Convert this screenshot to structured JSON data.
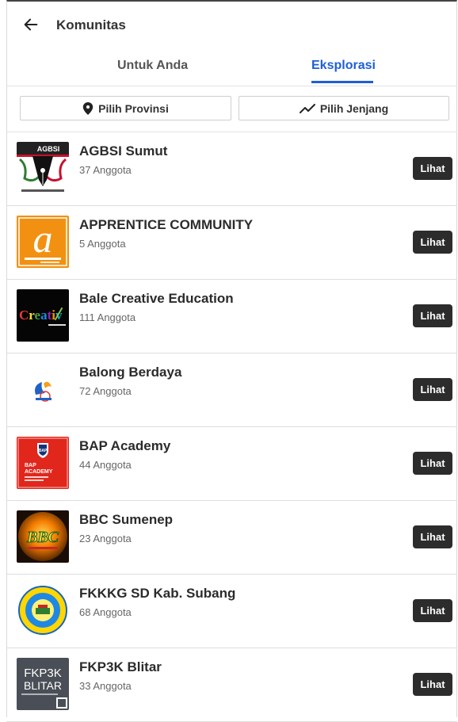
{
  "header": {
    "title": "Komunitas"
  },
  "tabs": [
    {
      "label": "Untuk Anda"
    },
    {
      "label": "Eksplorasi"
    }
  ],
  "filters": {
    "province": "Pilih Provinsi",
    "level": "Pilih Jenjang"
  },
  "communities": [
    {
      "name": "AGBSI Sumut",
      "members": "37 Anggota",
      "button": "Lihat",
      "logo_text": "AGBSI",
      "logo_icon": "pen-nib-logo"
    },
    {
      "name": "APPRENTICE COMMUNITY",
      "members": "5 Anggota",
      "button": "Lihat",
      "logo_text": "apprentice",
      "logo_icon": "letter-a-logo"
    },
    {
      "name": "Bale Creative Education",
      "members": "111 Anggota",
      "button": "Lihat",
      "logo_text": "Creativ",
      "logo_icon": "creative-logo"
    },
    {
      "name": "Balong Berdaya",
      "members": "72 Anggota",
      "button": "Lihat",
      "logo_text": "",
      "logo_icon": "balong-logo"
    },
    {
      "name": "BAP Academy",
      "members": "44 Anggota",
      "button": "Lihat",
      "logo_text": "BAP ACADEMY",
      "logo_icon": "shield-logo"
    },
    {
      "name": "BBC Sumenep",
      "members": "23 Anggota",
      "button": "Lihat",
      "logo_text": "BBC",
      "logo_icon": "bbc-logo"
    },
    {
      "name": "FKKKG SD Kab. Subang",
      "members": "68 Anggota",
      "button": "Lihat",
      "logo_text": "",
      "logo_icon": "round-seal-logo"
    },
    {
      "name": "FKP3K Blitar",
      "members": "33 Anggota",
      "button": "Lihat",
      "logo_text": "FKP3K BLITAR",
      "logo_icon": "fkp3k-logo"
    }
  ],
  "colors": {
    "accent": "#1d5fd6",
    "button_bg": "#2c2c2c"
  }
}
